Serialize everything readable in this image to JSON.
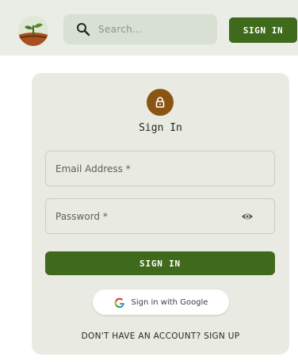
{
  "header": {
    "logo_icon": "plant-logo-icon",
    "search": {
      "placeholder": "Search...",
      "icon": "search-icon"
    },
    "signin_label": "SIGN IN"
  },
  "card": {
    "lock_icon": "lock-icon",
    "title": "Sign In",
    "email_label": "Email Address *",
    "password_label": "Password *",
    "password_toggle_icon": "eye-icon",
    "submit_label": "SIGN IN",
    "google_label": "Sign in with Google",
    "signup_text": "DON'T HAVE AN ACCOUNT? SIGN UP"
  },
  "colors": {
    "header_bg": "#e9ede6",
    "primary": "#3f6a1c",
    "accent": "#8a5513",
    "card_bg": "#e9ebe3"
  }
}
